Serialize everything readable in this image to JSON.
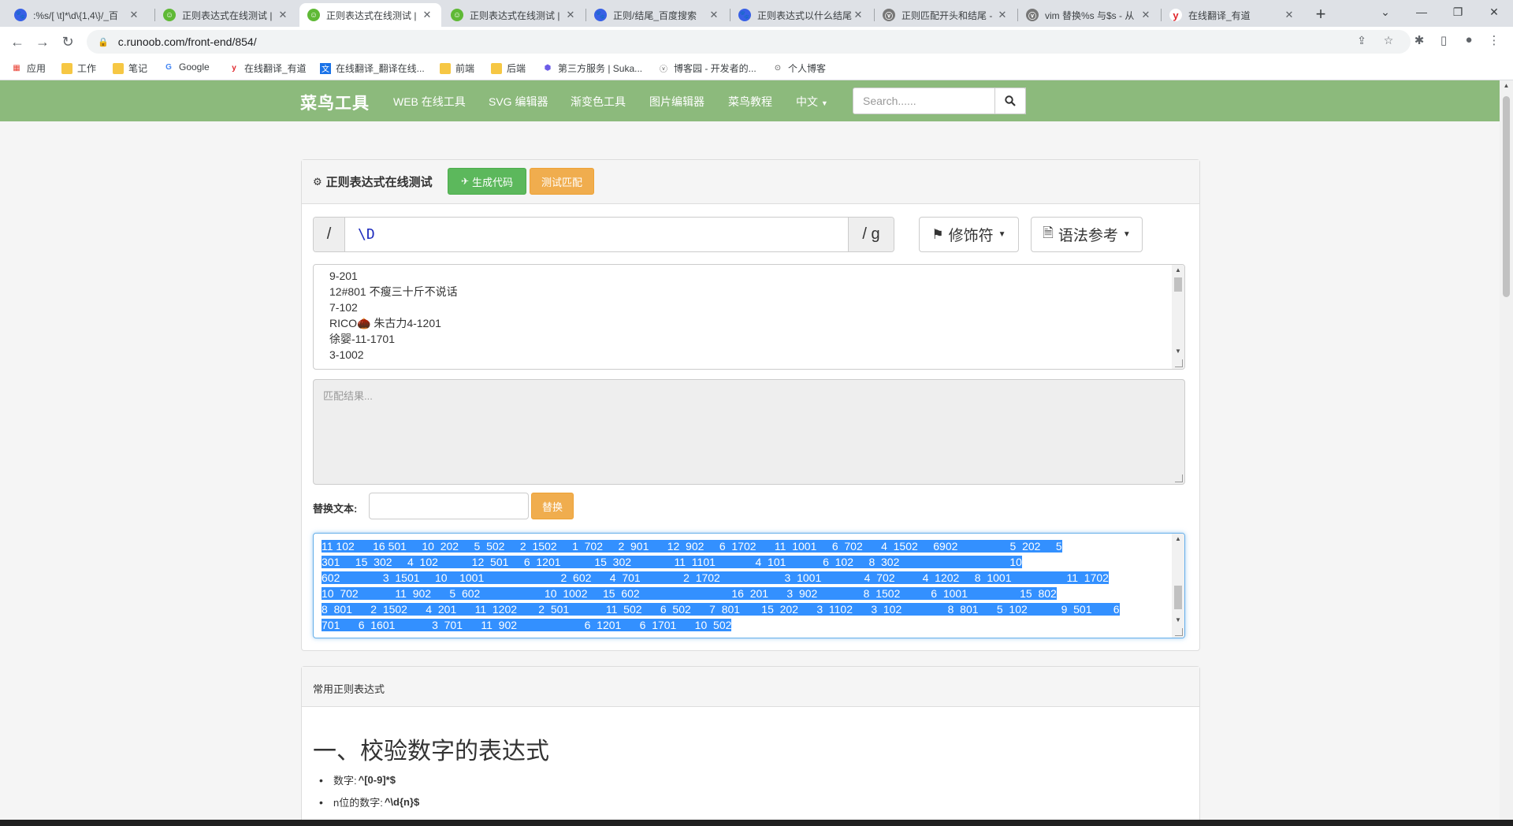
{
  "browser": {
    "tabs": [
      {
        "title": ":%s/[ \\t]*\\d\\{1,4\\}/_百",
        "icon": "baidu"
      },
      {
        "title": "正则表达式在线测试 |",
        "icon": "runoob"
      },
      {
        "title": "正则表达式在线测试 |",
        "icon": "runoob",
        "active": true
      },
      {
        "title": "正则表达式在线测试 |",
        "icon": "runoob"
      },
      {
        "title": "正则/结尾_百度搜索",
        "icon": "baidu"
      },
      {
        "title": "正则表达式以什么结尾",
        "icon": "baidu"
      },
      {
        "title": "正则匹配开头和结尾 -",
        "icon": "csdn"
      },
      {
        "title": "vim 替换%s 与$s - 从",
        "icon": "csdn"
      },
      {
        "title": "在线翻译_有道",
        "icon": "youdao"
      }
    ],
    "url": "c.runoob.com/front-end/854/",
    "bookmarks": [
      {
        "label": "应用",
        "type": "apps"
      },
      {
        "label": "工作",
        "type": "folder"
      },
      {
        "label": "笔记",
        "type": "folder"
      },
      {
        "label": "Google",
        "type": "google"
      },
      {
        "label": "在线翻译_有道",
        "type": "youdao"
      },
      {
        "label": "在线翻译_翻译在线...",
        "type": "page"
      },
      {
        "label": "前端",
        "type": "folder"
      },
      {
        "label": "后端",
        "type": "folder"
      },
      {
        "label": "第三方服务 | Suka...",
        "type": "page"
      },
      {
        "label": "博客园 - 开发者的...",
        "type": "page"
      },
      {
        "label": "个人博客",
        "type": "page"
      }
    ]
  },
  "navbar": {
    "brand": "菜鸟工具",
    "links": [
      "WEB 在线工具",
      "SVG 编辑器",
      "渐变色工具",
      "图片编辑器",
      "菜鸟教程",
      "中文"
    ],
    "search_placeholder": "Search......"
  },
  "tool": {
    "title": "正则表达式在线测试",
    "generate_label": "生成代码",
    "test_label": "测试匹配",
    "regex_prefix": "/",
    "regex_value": "\\D",
    "regex_suffix": "/ g",
    "modifier_label": "修饰符",
    "syntax_label": "语法参考",
    "source_lines": [
      "9-201",
      "12#801 不瘦三十斤不说话",
      "7-102",
      "RICO🌰 朱古力4-1201",
      "徐婴-11-1701",
      "3-1002",
      "      "
    ],
    "result_placeholder": "匹配结果...",
    "replace_label": "替换文本:",
    "replace_button": "替换",
    "output_lines": [
      "11 102      16 501     10  202     5  502     2  1502     1  702     2  901      12  902     6  1702      11  1001     6  702      4  1502     6902                 5  202     5",
      "301     15  302     4  102           12  501     6  1201           15  302              11  1101             4  101            6  102     8  302                                    10",
      "602              3  1501     10    1001                         2  602      4  701              2  1702                     3  1001              4  702         4  1202     8  1001                  11  1702",
      "10  702            11  902      5  602                     10  1002     15  602                              16  201      3  902               8  1502          6  1001                 15  802",
      "8  801      2  1502      4  201      11  1202       2  501            11  502      6  502      7  801       15  202      3  1102      3  102               8  801      5  102           9  501       6",
      "701      6  1601            3  701      11  902                      6  1201      6  1701      10  502"
    ]
  },
  "common": {
    "title": "常用正则表达式",
    "section_heading": "一、校验数字的表达式",
    "items": [
      {
        "label": "数字:",
        "expr": "^[0-9]*$"
      },
      {
        "label": "n位的数字:",
        "expr": "^\\d{n}$"
      }
    ]
  },
  "colors": {
    "navbar": "#8cba7c",
    "success": "#5cb85c",
    "warning": "#f0ad4e",
    "selection": "#3390ff",
    "regex_text": "#1e2bbd"
  }
}
